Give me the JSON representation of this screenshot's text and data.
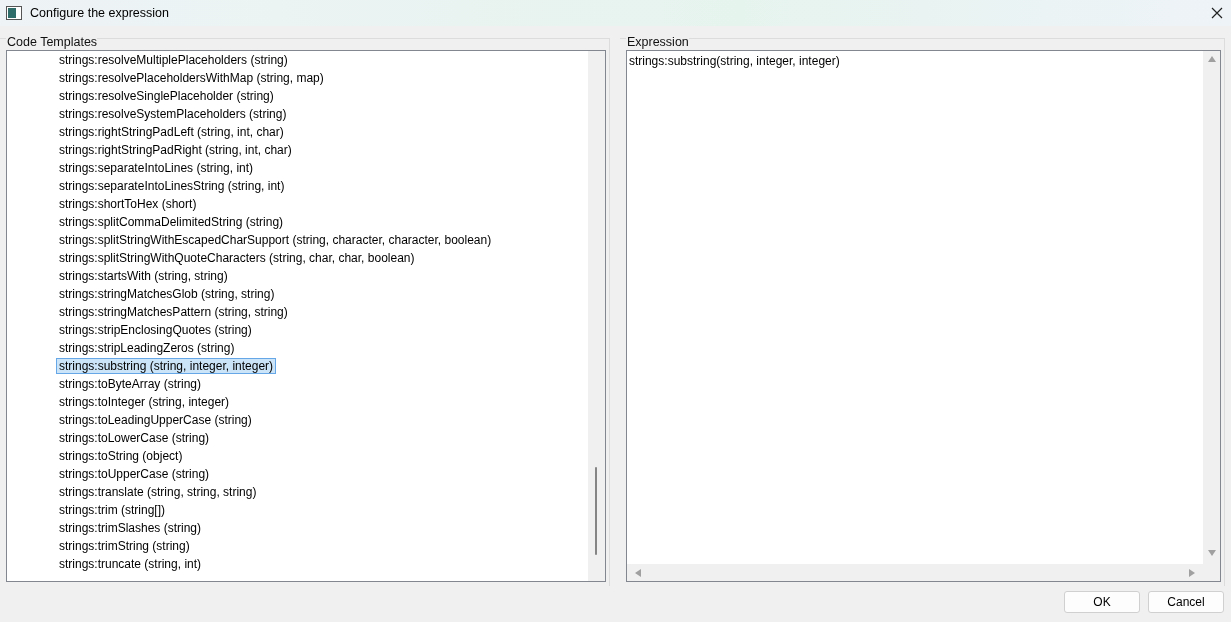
{
  "window": {
    "title": "Configure the expression"
  },
  "code_templates": {
    "label": "Code Templates",
    "items": [
      {
        "text": "strings:resolveMultiplePlaceholders (string)",
        "selected": false
      },
      {
        "text": "strings:resolvePlaceholdersWithMap (string, map)",
        "selected": false
      },
      {
        "text": "strings:resolveSinglePlaceholder (string)",
        "selected": false
      },
      {
        "text": "strings:resolveSystemPlaceholders (string)",
        "selected": false
      },
      {
        "text": "strings:rightStringPadLeft (string, int, char)",
        "selected": false
      },
      {
        "text": "strings:rightStringPadRight (string, int, char)",
        "selected": false
      },
      {
        "text": "strings:separateIntoLines (string, int)",
        "selected": false
      },
      {
        "text": "strings:separateIntoLinesString (string, int)",
        "selected": false
      },
      {
        "text": "strings:shortToHex (short)",
        "selected": false
      },
      {
        "text": "strings:splitCommaDelimitedString (string)",
        "selected": false
      },
      {
        "text": "strings:splitStringWithEscapedCharSupport (string, character, character, boolean)",
        "selected": false
      },
      {
        "text": "strings:splitStringWithQuoteCharacters (string, char, char, boolean)",
        "selected": false
      },
      {
        "text": "strings:startsWith (string, string)",
        "selected": false
      },
      {
        "text": "strings:stringMatchesGlob (string, string)",
        "selected": false
      },
      {
        "text": "strings:stringMatchesPattern (string, string)",
        "selected": false
      },
      {
        "text": "strings:stripEnclosingQuotes (string)",
        "selected": false
      },
      {
        "text": "strings:stripLeadingZeros (string)",
        "selected": false
      },
      {
        "text": "strings:substring (string, integer, integer)",
        "selected": true
      },
      {
        "text": "strings:toByteArray (string)",
        "selected": false
      },
      {
        "text": "strings:toInteger (string, integer)",
        "selected": false
      },
      {
        "text": "strings:toLeadingUpperCase (string)",
        "selected": false
      },
      {
        "text": "strings:toLowerCase (string)",
        "selected": false
      },
      {
        "text": "strings:toString (object)",
        "selected": false
      },
      {
        "text": "strings:toUpperCase (string)",
        "selected": false
      },
      {
        "text": "strings:translate (string, string, string)",
        "selected": false
      },
      {
        "text": "strings:trim (string[])",
        "selected": false
      },
      {
        "text": "strings:trimSlashes (string)",
        "selected": false
      },
      {
        "text": "strings:trimString (string)",
        "selected": false
      },
      {
        "text": "strings:truncate (string, int)",
        "selected": false
      }
    ]
  },
  "expression": {
    "label": "Expression",
    "value": "strings:substring(string, integer, integer)"
  },
  "buttons": [
    "OK",
    "Cancel"
  ]
}
